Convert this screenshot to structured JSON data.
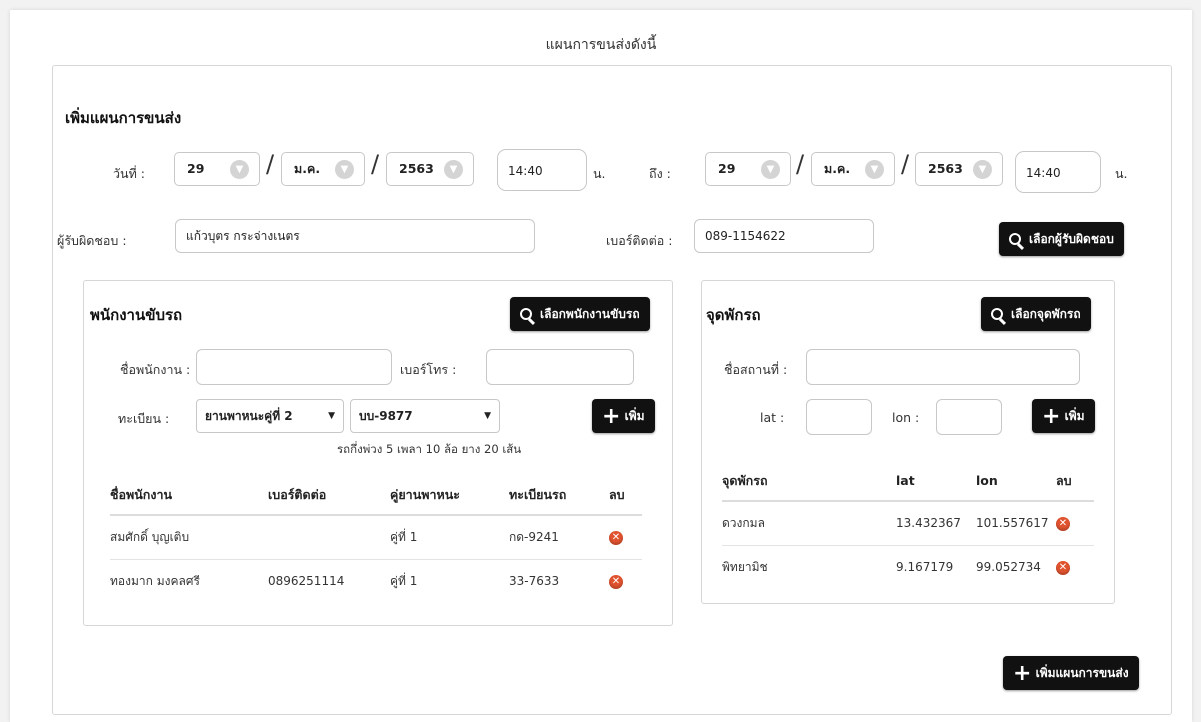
{
  "page": {
    "title": "แผนการขนส่งดังนี้"
  },
  "form": {
    "heading": "เพิ่มแผนการขนส่ง",
    "date_label": "วันที่ :",
    "to_label": "ถึง :",
    "unit_hour": "น.",
    "start": {
      "day": "29",
      "month": "ม.ค.",
      "year": "2563",
      "time": "14:40"
    },
    "end": {
      "day": "29",
      "month": "ม.ค.",
      "year": "2563",
      "time": "14:40"
    },
    "responsible_label": "ผู้รับผิดชอบ :",
    "responsible_value": "แก้วบุตร กระจ่างเนตร",
    "phone_label": "เบอร์ติดต่อ :",
    "phone_value": "089-1154622",
    "choose_responsible_button": "เลือกผู้รับผิดชอบ"
  },
  "drivers": {
    "heading": "พนักงานขับรถ",
    "choose_button": "เลือกพนักงานขับรถ",
    "name_label": "ชื่อพนักงาน :",
    "tel_label": "เบอร์โทร :",
    "plate_label": "ทะเบียน :",
    "vehicle_select": "ยานพาหนะคู่ที่ 2",
    "plate_select": "บบ-9877",
    "add_button": "เพิ่ม",
    "vehicle_note": "รถกึ่งพ่วง 5 เพลา 10 ล้อ ยาง 20 เส้น",
    "columns": [
      "ชื่อพนักงาน",
      "เบอร์ติดต่อ",
      "คู่ยานพาหนะ",
      "ทะเบียนรถ",
      "ลบ"
    ],
    "rows": [
      {
        "name": "สมศักดิ์ บุญเติบ",
        "phone": "",
        "pair": "คู่ที่ 1",
        "plate": "กด-9241"
      },
      {
        "name": "ทองมาก มงคลศรี",
        "phone": "0896251114",
        "pair": "คู่ที่ 1",
        "plate": "33-7633"
      }
    ]
  },
  "stops": {
    "heading": "จุดพักรถ",
    "choose_button": "เลือกจุดพักรถ",
    "place_label": "ชื่อสถานที่ :",
    "lat_label": "lat :",
    "lon_label": "lon :",
    "add_button": "เพิ่ม",
    "columns": [
      "จุดพักรถ",
      "lat",
      "lon",
      "ลบ"
    ],
    "rows": [
      {
        "name": "ดวงกมล",
        "lat": "13.432367",
        "lon": "101.557617"
      },
      {
        "name": "พิทยามิช",
        "lat": "9.167179",
        "lon": "99.052734"
      }
    ]
  },
  "footer": {
    "add_plan_button": "เพิ่มแผนการขนส่ง"
  },
  "icons": {
    "search": "search-icon",
    "plus": "plus-icon",
    "delete": "delete-icon",
    "chevron": "chevron-down-icon"
  },
  "colors": {
    "button": "#111111",
    "delete": "#e0532f",
    "border": "#d6d6d6"
  }
}
